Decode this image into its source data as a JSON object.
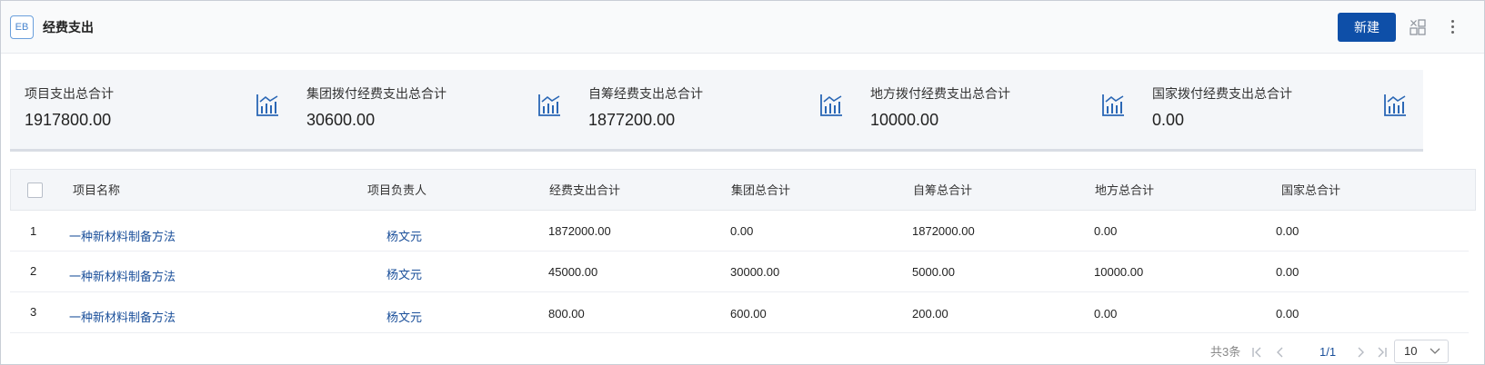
{
  "header": {
    "logo_text": "EB",
    "title": "经费支出",
    "new_button": "新建"
  },
  "cards": [
    {
      "label": "项目支出总合计",
      "value": "1917800.00"
    },
    {
      "label": "集团拨付经费支出总合计",
      "value": "30600.00"
    },
    {
      "label": "自筹经费支出总合计",
      "value": "1877200.00"
    },
    {
      "label": "地方拨付经费支出总合计",
      "value": "10000.00"
    },
    {
      "label": "国家拨付经费支出总合计",
      "value": "0.00"
    }
  ],
  "table": {
    "columns": [
      "项目名称",
      "项目负责人",
      "经费支出合计",
      "集团总合计",
      "自筹总合计",
      "地方总合计",
      "国家总合计"
    ],
    "rows": [
      {
        "index": "1",
        "name": "一种新材料制备方法",
        "owner": "杨文元",
        "total": "1872000.00",
        "group": "0.00",
        "self": "1872000.00",
        "local": "0.00",
        "national": "0.00"
      },
      {
        "index": "2",
        "name": "一种新材料制备方法",
        "owner": "杨文元",
        "total": "45000.00",
        "group": "30000.00",
        "self": "5000.00",
        "local": "10000.00",
        "national": "0.00"
      },
      {
        "index": "3",
        "name": "一种新材料制备方法",
        "owner": "杨文元",
        "total": "800.00",
        "group": "600.00",
        "self": "200.00",
        "local": "0.00",
        "national": "0.00"
      }
    ]
  },
  "pagination": {
    "total_text": "共3条",
    "current": "1/1",
    "page_size": "10"
  },
  "colors": {
    "primary": "#0e4fa8",
    "link": "#1a4f9a",
    "card_bg": "#f4f6f9"
  }
}
